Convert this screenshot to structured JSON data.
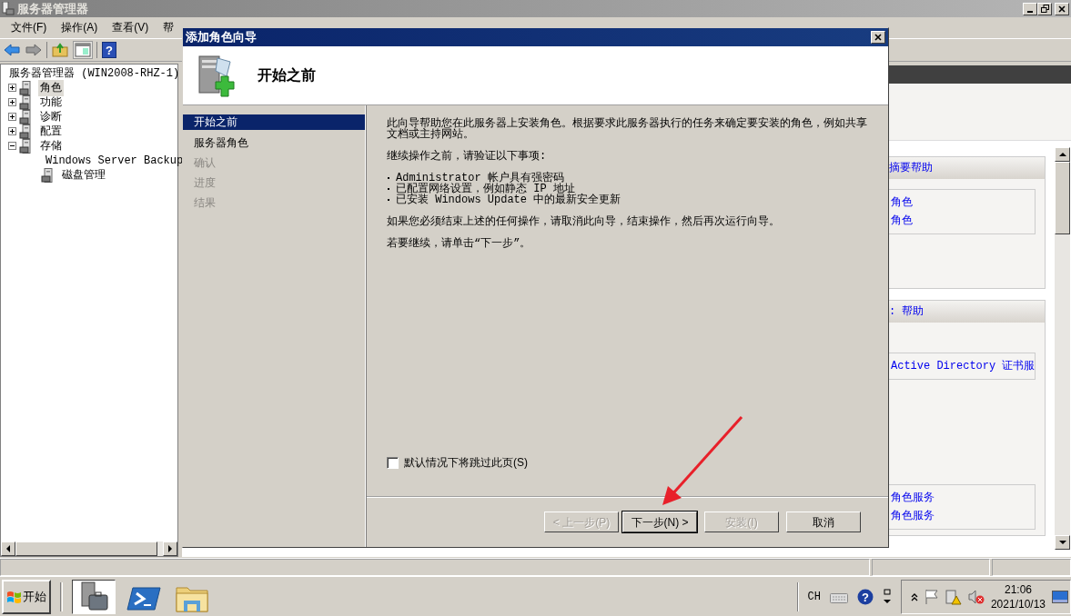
{
  "window": {
    "title": "服务器管理器"
  },
  "menu": [
    "文件(F)",
    "操作(A)",
    "查看(V)",
    "帮"
  ],
  "toolbar": {
    "help_glyph": "?"
  },
  "tree": [
    {
      "label": "服务器管理器 (WIN2008-RHZ-1)",
      "selected": false,
      "children": [
        {
          "label": "角色",
          "expanded": false,
          "selected": true
        },
        {
          "label": "功能",
          "expanded": false,
          "selected": false
        },
        {
          "label": "诊断",
          "expanded": false,
          "selected": false
        },
        {
          "label": "配置",
          "expanded": false,
          "selected": false
        },
        {
          "label": "存储",
          "expanded": true,
          "selected": false,
          "children": [
            {
              "label": "Windows Server Backup",
              "selected": false
            },
            {
              "label": "磁盘管理",
              "selected": false
            }
          ]
        }
      ]
    }
  ],
  "background_pane": {
    "sections": [
      {
        "header": "摘要帮助",
        "boxes": [
          [
            "角色",
            "角色"
          ]
        ]
      },
      {
        "header": ": 帮助",
        "boxes": [
          [
            "Active Directory 证书服"
          ],
          [
            "角色服务",
            "角色服务"
          ]
        ]
      }
    ]
  },
  "dialog": {
    "title": "添加角色向导",
    "heading": "开始之前",
    "steps": [
      {
        "label": "开始之前",
        "selected": true,
        "disabled": false
      },
      {
        "label": "服务器角色",
        "selected": false,
        "disabled": false
      },
      {
        "label": "确认",
        "selected": false,
        "disabled": true
      },
      {
        "label": "进度",
        "selected": false,
        "disabled": true
      },
      {
        "label": "结果",
        "selected": false,
        "disabled": true
      }
    ],
    "content": [
      {
        "kind": "paragraph",
        "text": "此向导帮助您在此服务器上安装角色。根据要求此服务器执行的任务来确定要安装的角色，例如共享文档或主持网站。"
      },
      {
        "kind": "paragraph",
        "text": "继续操作之前，请验证以下事项:"
      },
      {
        "kind": "bullets",
        "items": [
          "Administrator 帐户具有强密码",
          "已配置网络设置，例如静态 IP 地址",
          "已安装 Windows Update 中的最新安全更新"
        ]
      },
      {
        "kind": "paragraph",
        "text": "如果您必须结束上述的任何操作，请取消此向导，结束操作，然后再次运行向导。"
      },
      {
        "kind": "paragraph",
        "text": "若要继续，请单击“下一步”。"
      }
    ],
    "skip_checkbox": {
      "label": "默认情况下将跳过此页(S)",
      "checked": false
    },
    "buttons": [
      {
        "label": "< 上一步(P)",
        "disabled": true,
        "default": false
      },
      {
        "label": "下一步(N) >",
        "disabled": false,
        "default": true
      },
      {
        "label": "安装(I)",
        "disabled": true,
        "default": false
      },
      {
        "label": "取消",
        "disabled": false,
        "default": false
      }
    ]
  },
  "taskbar": {
    "start": "开始",
    "apps": [
      {
        "kind": "server",
        "selected": true
      },
      {
        "kind": "shell",
        "selected": false
      },
      {
        "kind": "folder",
        "selected": false
      }
    ],
    "input_language": "CH",
    "help_glyph": "?",
    "time": "21:06",
    "date": "2021/10/13"
  }
}
